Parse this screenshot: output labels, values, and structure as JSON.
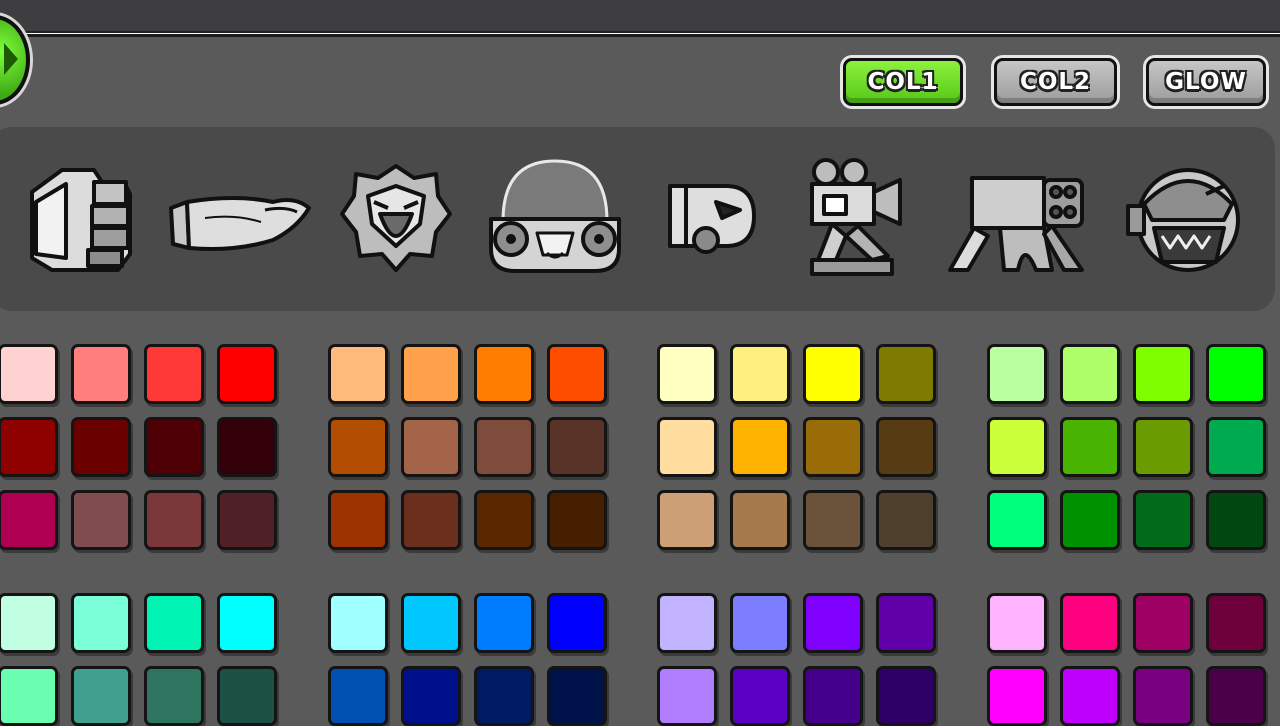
{
  "header": {
    "back_button_icon": "green-arrow-icon",
    "buttons": [
      {
        "label": "COL1",
        "selected": true,
        "color": "#6ddf28"
      },
      {
        "label": "COL2",
        "selected": false,
        "color": "#b4b4b4"
      },
      {
        "label": "GLOW",
        "selected": false,
        "color": "#b4b4b4"
      }
    ]
  },
  "icons": [
    "fist-icon",
    "hand-icon",
    "spiky-creature-icon",
    "dome-face-icon",
    "bullet-face-icon",
    "camera-robot-icon",
    "cannon-spider-icon",
    "armored-head-icon"
  ],
  "palette": {
    "top": {
      "red": [
        [
          "#ffd2d2",
          "#ff7f7f",
          "#ff3838",
          "#ff0000"
        ],
        [
          "#8f0000",
          "#6a0000",
          "#4f0006",
          "#330009"
        ],
        [
          "#af0054",
          "#7f4d4f",
          "#7b383a",
          "#4f2026"
        ]
      ],
      "orange": [
        [
          "#ffbb7c",
          "#ffa04a",
          "#ff7d00",
          "#ff4d00"
        ],
        [
          "#b34d00",
          "#a3644a",
          "#7f4c3c",
          "#5a3328"
        ],
        [
          "#9d3300",
          "#6c2e1d",
          "#5a2800",
          "#461e00"
        ]
      ],
      "yellow": [
        [
          "#ffffc0",
          "#ffef7f",
          "#ffff00",
          "#7f7a00"
        ],
        [
          "#ffdea0",
          "#ffb300",
          "#9a6c08",
          "#573b12"
        ],
        [
          "#cc9f74",
          "#a67a4d",
          "#6b523a",
          "#4f3f2d"
        ]
      ],
      "green": [
        [
          "#baffa0",
          "#afff6a",
          "#7dff00",
          "#00ff00"
        ],
        [
          "#caff3a",
          "#48b300",
          "#6a9b00",
          "#00ab4f"
        ],
        [
          "#00ff7d",
          "#009100",
          "#006b19",
          "#004711"
        ]
      ]
    },
    "bottom": {
      "cyan": [
        [
          "#c1ffe2",
          "#7bffd8",
          "#00f5b5",
          "#00ffff"
        ],
        [
          "#6affb0",
          "#40a28e",
          "#2f745e",
          "#1c5246"
        ]
      ],
      "blue": [
        [
          "#a0ffff",
          "#00c8ff",
          "#007dff",
          "#0000ff"
        ],
        [
          "#0050b2",
          "#00108b",
          "#001a63",
          "#00124a"
        ]
      ],
      "purple": [
        [
          "#c1b3ff",
          "#7d7dff",
          "#7f00ff",
          "#5f00a8"
        ],
        [
          "#b17dff",
          "#5c00c4",
          "#44008b",
          "#2e0066"
        ]
      ],
      "pink": [
        [
          "#ffb3ff",
          "#ff0080",
          "#9e0063",
          "#6e003b"
        ],
        [
          "#ff00ff",
          "#c000ff",
          "#7a0082",
          "#4a0048"
        ]
      ]
    }
  }
}
